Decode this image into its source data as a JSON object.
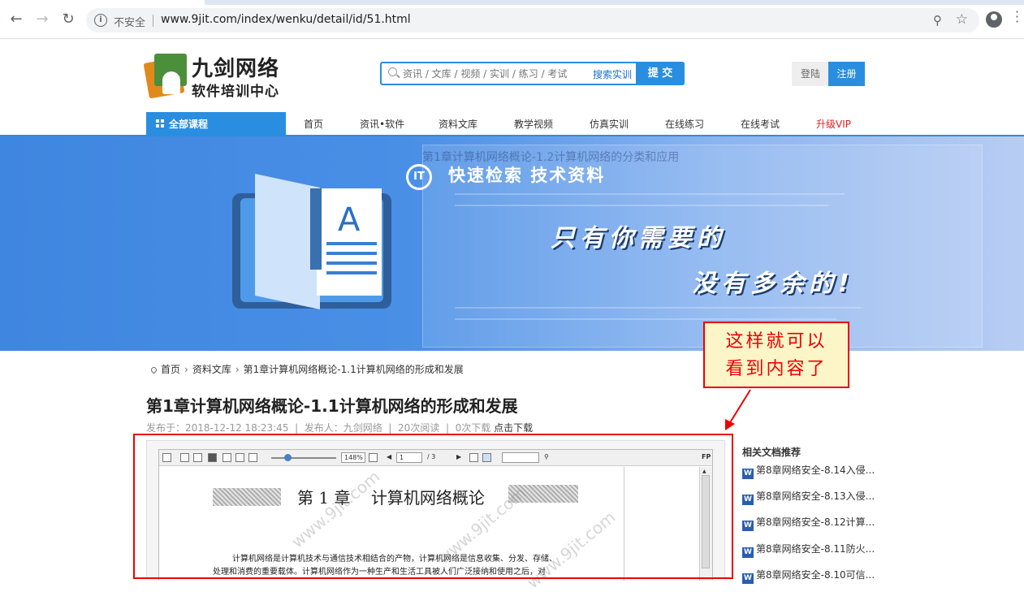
{
  "browser": {
    "security_label": "不安全",
    "url": "www.9jit.com/index/wenku/detail/id/51.html"
  },
  "header": {
    "logo_line1": "九剑网络",
    "logo_line2": "软件培训中心",
    "search_placeholder": "资讯 / 文库 / 视频 / 实训 / 练习 / 考试",
    "search_scope": "搜索实训",
    "search_submit": "提 交",
    "login": "登陆",
    "register": "注册"
  },
  "nav": {
    "all_courses": "全部课程",
    "items": [
      "首页",
      "资讯•软件",
      "资料文库",
      "教学视频",
      "仿真实训",
      "在线练习",
      "在线考试",
      "升级VIP"
    ]
  },
  "banner": {
    "tagline": "快速检索    技术资料",
    "slogan1": "只有你需要的",
    "slogan2": "没有多余的!",
    "bg_title": "第1章计算机网络概论-1.2计算机网络的分类和应用"
  },
  "breadcrumb": {
    "home": "首页",
    "section": "资料文库",
    "current": "第1章计算机网络概论-1.1计算机网络的形成和发展"
  },
  "document": {
    "title": "第1章计算机网络概论-1.1计算机网络的形成和发展",
    "meta": "发布于：2018-12-12 18:23:45  |  发布人：九剑网络  |  20次阅读  |  0次下载",
    "download_link": "点击下载"
  },
  "viewer": {
    "zoom": "148%",
    "page_current": "1",
    "page_total": "/ 3",
    "chapter_heading": "第 1 章    计算机网络概论",
    "para_line1": "计算机网络是计算机技术与通信技术相结合的产物，计算机网络是信息收集、分发、存储、",
    "para_line2": "处理和消费的重要载体。计算机网络作为一种生产和生活工具被人们广泛接纳和使用之后，对",
    "watermark": "www.9jit.com"
  },
  "annotation": {
    "line1": "这样就可以",
    "line2": "看到内容了",
    "color": "#e00000"
  },
  "sidebar": {
    "title": "相关文档推荐",
    "items": [
      "第8章网络安全-8.14入侵...",
      "第8章网络安全-8.13入侵...",
      "第8章网络安全-8.12计算...",
      "第8章网络安全-8.11防火...",
      "第8章网络安全-8.10可信..."
    ]
  }
}
